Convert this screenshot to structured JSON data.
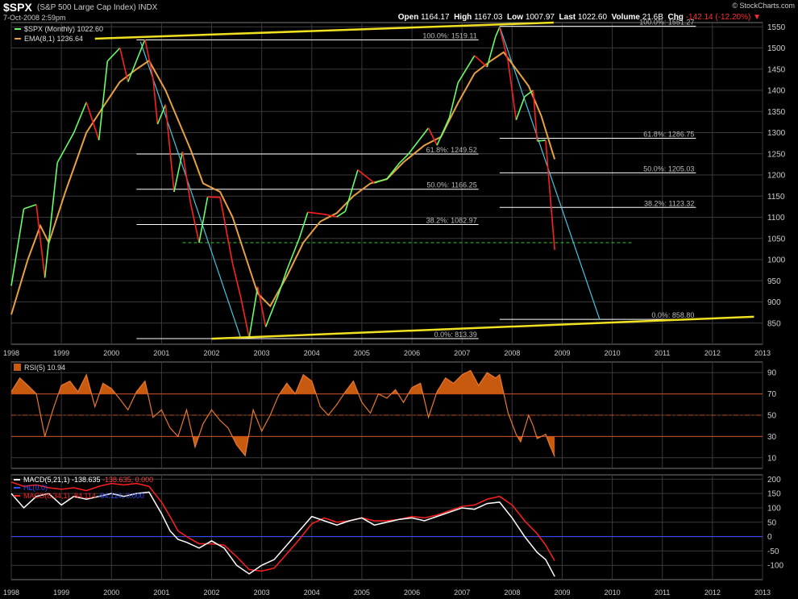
{
  "header": {
    "symbol": "$SPX",
    "name": "(S&P 500 Large Cap Index)",
    "exchange": "INDX",
    "date": "7-Oct-2008 2:59pm",
    "brand": "© StockCharts.com",
    "open_label": "Open",
    "open": "1164.17",
    "high_label": "High",
    "high": "1167.03",
    "low_label": "Low",
    "low": "1007.97",
    "last_label": "Last",
    "last": "1022.60",
    "volume_label": "Volume",
    "volume": "21.6B",
    "chg_label": "Chg",
    "chg": "-142.14 (-12.20%)",
    "down_arrow": "down-triangle-icon"
  },
  "colors": {
    "background": "#000000",
    "grid": "#3a3a3a",
    "bar_up": "#66ff66",
    "bar_down": "#ff2020",
    "ema": "#e8a040",
    "trendline": "#f0e020",
    "fib_line": "#ffffff",
    "fib_text": "#bbbbbb",
    "fan_line": "#40c8e0",
    "support": "#33cc33",
    "rsi_line": "#e87830",
    "rsi_fill": "#c85a10",
    "macd_line": "#ffffff",
    "macd_signal": "#ff2020",
    "zero_line": "#3050ff"
  },
  "chart_data": [
    {
      "type": "line",
      "panel": "price",
      "legend": [
        {
          "label": "$SPX (Monthly) 1022.60",
          "color": "#66ff66"
        },
        {
          "label": "EMA(8,1) 1236.64",
          "color": "#e8a040"
        }
      ],
      "x_ticks": [
        "1998",
        "1999",
        "2000",
        "2001",
        "2002",
        "2003",
        "2004",
        "2005",
        "2006",
        "2007",
        "2008",
        "2009",
        "2010",
        "2011",
        "2012",
        "2013"
      ],
      "ylim": [
        800,
        1560
      ],
      "y_ticks": [
        850,
        900,
        950,
        1000,
        1050,
        1100,
        1150,
        1200,
        1250,
        1300,
        1350,
        1400,
        1450,
        1500,
        1550
      ],
      "x_start": "1998-01",
      "price_points": [
        [
          1998.0,
          938
        ],
        [
          1998.25,
          1120
        ],
        [
          1998.5,
          1130
        ],
        [
          1998.67,
          957
        ],
        [
          1998.92,
          1229
        ],
        [
          1999.25,
          1300
        ],
        [
          1999.5,
          1372
        ],
        [
          1999.75,
          1282
        ],
        [
          1999.92,
          1469
        ],
        [
          2000.17,
          1500
        ],
        [
          2000.33,
          1420
        ],
        [
          2000.5,
          1470
        ],
        [
          2000.67,
          1520
        ],
        [
          2000.83,
          1429
        ],
        [
          2000.92,
          1320
        ],
        [
          2001.08,
          1366
        ],
        [
          2001.25,
          1160
        ],
        [
          2001.42,
          1255
        ],
        [
          2001.58,
          1133
        ],
        [
          2001.75,
          1040
        ],
        [
          2001.92,
          1148
        ],
        [
          2002.17,
          1147
        ],
        [
          2002.42,
          990
        ],
        [
          2002.58,
          912
        ],
        [
          2002.75,
          815
        ],
        [
          2002.92,
          936
        ],
        [
          2003.08,
          841
        ],
        [
          2003.33,
          916
        ],
        [
          2003.5,
          975
        ],
        [
          2003.75,
          1050
        ],
        [
          2003.92,
          1112
        ],
        [
          2004.25,
          1107
        ],
        [
          2004.5,
          1101
        ],
        [
          2004.67,
          1114
        ],
        [
          2004.92,
          1212
        ],
        [
          2005.25,
          1181
        ],
        [
          2005.5,
          1191
        ],
        [
          2005.75,
          1228
        ],
        [
          2005.92,
          1248
        ],
        [
          2006.33,
          1311
        ],
        [
          2006.5,
          1270
        ],
        [
          2006.75,
          1336
        ],
        [
          2006.92,
          1418
        ],
        [
          2007.25,
          1482
        ],
        [
          2007.5,
          1455
        ],
        [
          2007.67,
          1527
        ],
        [
          2007.75,
          1549
        ],
        [
          2007.92,
          1468
        ],
        [
          2008.08,
          1330
        ],
        [
          2008.25,
          1385
        ],
        [
          2008.42,
          1400
        ],
        [
          2008.5,
          1280
        ],
        [
          2008.67,
          1282
        ],
        [
          2008.75,
          1166
        ],
        [
          2008.85,
          1023
        ]
      ],
      "ema_points": [
        [
          1998.0,
          870
        ],
        [
          1998.33,
          1000
        ],
        [
          1998.58,
          1080
        ],
        [
          1998.75,
          1040
        ],
        [
          1999.08,
          1160
        ],
        [
          1999.5,
          1300
        ],
        [
          1999.83,
          1360
        ],
        [
          2000.17,
          1420
        ],
        [
          2000.5,
          1450
        ],
        [
          2000.75,
          1470
        ],
        [
          2001.08,
          1400
        ],
        [
          2001.33,
          1330
        ],
        [
          2001.58,
          1260
        ],
        [
          2001.83,
          1180
        ],
        [
          2002.17,
          1160
        ],
        [
          2002.42,
          1100
        ],
        [
          2002.67,
          1010
        ],
        [
          2002.92,
          920
        ],
        [
          2003.17,
          890
        ],
        [
          2003.5,
          960
        ],
        [
          2003.83,
          1040
        ],
        [
          2004.17,
          1090
        ],
        [
          2004.5,
          1110
        ],
        [
          2004.83,
          1150
        ],
        [
          2005.17,
          1180
        ],
        [
          2005.5,
          1190
        ],
        [
          2005.83,
          1230
        ],
        [
          2006.25,
          1270
        ],
        [
          2006.58,
          1290
        ],
        [
          2006.92,
          1370
        ],
        [
          2007.25,
          1440
        ],
        [
          2007.58,
          1470
        ],
        [
          2007.83,
          1490
        ],
        [
          2008.08,
          1450
        ],
        [
          2008.33,
          1410
        ],
        [
          2008.58,
          1340
        ],
        [
          2008.85,
          1237
        ]
      ],
      "trendlines": [
        {
          "from": [
            1999.67,
            1522
          ],
          "to": [
            2008.83,
            1560
          ]
        },
        {
          "from": [
            2002.0,
            813
          ],
          "to": [
            2012.83,
            865
          ]
        }
      ],
      "fib_sets": [
        {
          "x_range": [
            2000.5,
            2007.33
          ],
          "levels": [
            {
              "label": "100.0%: 1519.11",
              "value": 1519.11
            },
            {
              "label": "61.8%: 1249.52",
              "value": 1249.52
            },
            {
              "label": "50.0%: 1166.25",
              "value": 1166.25
            },
            {
              "label": "38.2%: 1082.97",
              "value": 1082.97
            },
            {
              "label": "0.0%: 813.39",
              "value": 813.39
            }
          ]
        },
        {
          "x_range": [
            2007.75,
            2011.67
          ],
          "levels": [
            {
              "label": "100.0%: 1551.27",
              "value": 1551.27
            },
            {
              "label": "61.8%: 1286.75",
              "value": 1286.75
            },
            {
              "label": "50.0%: 1205.03",
              "value": 1205.03
            },
            {
              "label": "38.2%: 1123.32",
              "value": 1123.32
            },
            {
              "label": "0.0%: 858.80",
              "value": 858.8
            }
          ]
        }
      ],
      "fan_lines": [
        {
          "from": [
            2000.58,
            1515
          ],
          "to": [
            2002.58,
            815
          ]
        },
        {
          "from": [
            2007.75,
            1551
          ],
          "to": [
            2009.75,
            858
          ]
        }
      ],
      "support_line": {
        "value": 1040,
        "x_range": [
          2001.42,
          2010.42
        ]
      }
    },
    {
      "type": "area",
      "panel": "rsi",
      "legend": [
        {
          "label": "RSI(5) 10.94",
          "color": "#e87830"
        }
      ],
      "ylim": [
        0,
        100
      ],
      "y_ticks": [
        10,
        30,
        50,
        70,
        90
      ],
      "bands": [
        30,
        50,
        70
      ],
      "points": [
        [
          1998.0,
          72
        ],
        [
          1998.17,
          85
        ],
        [
          1998.33,
          78
        ],
        [
          1998.5,
          70
        ],
        [
          1998.67,
          30
        ],
        [
          1998.83,
          55
        ],
        [
          1999.0,
          78
        ],
        [
          1999.17,
          82
        ],
        [
          1999.33,
          72
        ],
        [
          1999.5,
          88
        ],
        [
          1999.67,
          58
        ],
        [
          1999.83,
          80
        ],
        [
          2000.0,
          75
        ],
        [
          2000.17,
          65
        ],
        [
          2000.33,
          55
        ],
        [
          2000.5,
          72
        ],
        [
          2000.67,
          82
        ],
        [
          2000.83,
          48
        ],
        [
          2001.0,
          55
        ],
        [
          2001.17,
          38
        ],
        [
          2001.33,
          30
        ],
        [
          2001.5,
          55
        ],
        [
          2001.67,
          20
        ],
        [
          2001.83,
          42
        ],
        [
          2002.0,
          55
        ],
        [
          2002.17,
          45
        ],
        [
          2002.33,
          38
        ],
        [
          2002.5,
          22
        ],
        [
          2002.67,
          12
        ],
        [
          2002.83,
          55
        ],
        [
          2003.0,
          35
        ],
        [
          2003.17,
          50
        ],
        [
          2003.33,
          68
        ],
        [
          2003.5,
          80
        ],
        [
          2003.67,
          70
        ],
        [
          2003.83,
          88
        ],
        [
          2004.0,
          82
        ],
        [
          2004.17,
          58
        ],
        [
          2004.33,
          50
        ],
        [
          2004.5,
          60
        ],
        [
          2004.67,
          72
        ],
        [
          2004.83,
          82
        ],
        [
          2005.0,
          62
        ],
        [
          2005.17,
          52
        ],
        [
          2005.33,
          70
        ],
        [
          2005.5,
          66
        ],
        [
          2005.67,
          74
        ],
        [
          2005.83,
          62
        ],
        [
          2006.0,
          76
        ],
        [
          2006.17,
          80
        ],
        [
          2006.33,
          48
        ],
        [
          2006.5,
          72
        ],
        [
          2006.67,
          85
        ],
        [
          2006.83,
          80
        ],
        [
          2007.0,
          88
        ],
        [
          2007.17,
          92
        ],
        [
          2007.33,
          78
        ],
        [
          2007.5,
          90
        ],
        [
          2007.67,
          85
        ],
        [
          2007.75,
          88
        ],
        [
          2007.92,
          52
        ],
        [
          2008.08,
          32
        ],
        [
          2008.17,
          25
        ],
        [
          2008.33,
          50
        ],
        [
          2008.42,
          40
        ],
        [
          2008.5,
          28
        ],
        [
          2008.67,
          32
        ],
        [
          2008.75,
          22
        ],
        [
          2008.85,
          11
        ]
      ]
    },
    {
      "type": "line",
      "panel": "macd",
      "legend": [
        {
          "label": "MACD(5,21,1)",
          "value": "-138.635",
          "extra": "-138.635, 0.000",
          "color": "#ffffff"
        },
        {
          "label": "HL(0.0)",
          "color": "#3050ff"
        },
        {
          "label": "MACD(8,34,1)",
          "value": "-84.114",
          "extra": "-84.114, 0.000",
          "color": "#ff2020"
        }
      ],
      "ylim": [
        -150,
        215
      ],
      "y_ticks": [
        -100,
        -50,
        0,
        50,
        100,
        150,
        200
      ],
      "y_tick_labels": [
        "-100",
        "-50",
        "0",
        "50",
        "100",
        "150",
        "200"
      ],
      "macd_5_21": [
        [
          1998.0,
          150
        ],
        [
          1998.25,
          100
        ],
        [
          1998.5,
          140
        ],
        [
          1998.75,
          150
        ],
        [
          1999.0,
          110
        ],
        [
          1999.25,
          140
        ],
        [
          1999.5,
          130
        ],
        [
          1999.75,
          140
        ],
        [
          2000.0,
          150
        ],
        [
          2000.25,
          140
        ],
        [
          2000.5,
          150
        ],
        [
          2000.75,
          155
        ],
        [
          2001.0,
          80
        ],
        [
          2001.17,
          20
        ],
        [
          2001.33,
          -10
        ],
        [
          2001.5,
          -20
        ],
        [
          2001.75,
          -40
        ],
        [
          2002.0,
          -15
        ],
        [
          2002.25,
          -40
        ],
        [
          2002.5,
          -100
        ],
        [
          2002.75,
          -130
        ],
        [
          2003.0,
          -100
        ],
        [
          2003.25,
          -80
        ],
        [
          2003.5,
          -30
        ],
        [
          2003.75,
          20
        ],
        [
          2004.0,
          70
        ],
        [
          2004.25,
          55
        ],
        [
          2004.5,
          40
        ],
        [
          2004.75,
          55
        ],
        [
          2005.0,
          65
        ],
        [
          2005.25,
          40
        ],
        [
          2005.5,
          50
        ],
        [
          2005.75,
          60
        ],
        [
          2006.0,
          65
        ],
        [
          2006.25,
          55
        ],
        [
          2006.5,
          70
        ],
        [
          2006.75,
          85
        ],
        [
          2007.0,
          100
        ],
        [
          2007.25,
          95
        ],
        [
          2007.5,
          115
        ],
        [
          2007.75,
          120
        ],
        [
          2008.0,
          65
        ],
        [
          2008.25,
          0
        ],
        [
          2008.5,
          -55
        ],
        [
          2008.67,
          -80
        ],
        [
          2008.85,
          -139
        ]
      ],
      "macd_8_34": [
        [
          1998.0,
          190
        ],
        [
          1998.25,
          175
        ],
        [
          1998.5,
          180
        ],
        [
          1998.75,
          170
        ],
        [
          1999.0,
          165
        ],
        [
          1999.25,
          170
        ],
        [
          1999.5,
          160
        ],
        [
          1999.75,
          175
        ],
        [
          2000.0,
          185
        ],
        [
          2000.25,
          180
        ],
        [
          2000.5,
          185
        ],
        [
          2000.75,
          175
        ],
        [
          2001.0,
          120
        ],
        [
          2001.17,
          70
        ],
        [
          2001.33,
          20
        ],
        [
          2001.5,
          0
        ],
        [
          2001.75,
          -25
        ],
        [
          2002.0,
          -25
        ],
        [
          2002.25,
          -30
        ],
        [
          2002.5,
          -70
        ],
        [
          2002.75,
          -115
        ],
        [
          2003.0,
          -120
        ],
        [
          2003.25,
          -110
        ],
        [
          2003.5,
          -60
        ],
        [
          2003.75,
          -10
        ],
        [
          2004.0,
          45
        ],
        [
          2004.25,
          65
        ],
        [
          2004.5,
          50
        ],
        [
          2004.75,
          55
        ],
        [
          2005.0,
          65
        ],
        [
          2005.25,
          55
        ],
        [
          2005.5,
          55
        ],
        [
          2005.75,
          60
        ],
        [
          2006.0,
          70
        ],
        [
          2006.25,
          65
        ],
        [
          2006.5,
          75
        ],
        [
          2006.75,
          90
        ],
        [
          2007.0,
          105
        ],
        [
          2007.25,
          110
        ],
        [
          2007.5,
          130
        ],
        [
          2007.75,
          140
        ],
        [
          2008.0,
          110
        ],
        [
          2008.25,
          55
        ],
        [
          2008.5,
          10
        ],
        [
          2008.67,
          -30
        ],
        [
          2008.85,
          -84
        ]
      ]
    }
  ]
}
